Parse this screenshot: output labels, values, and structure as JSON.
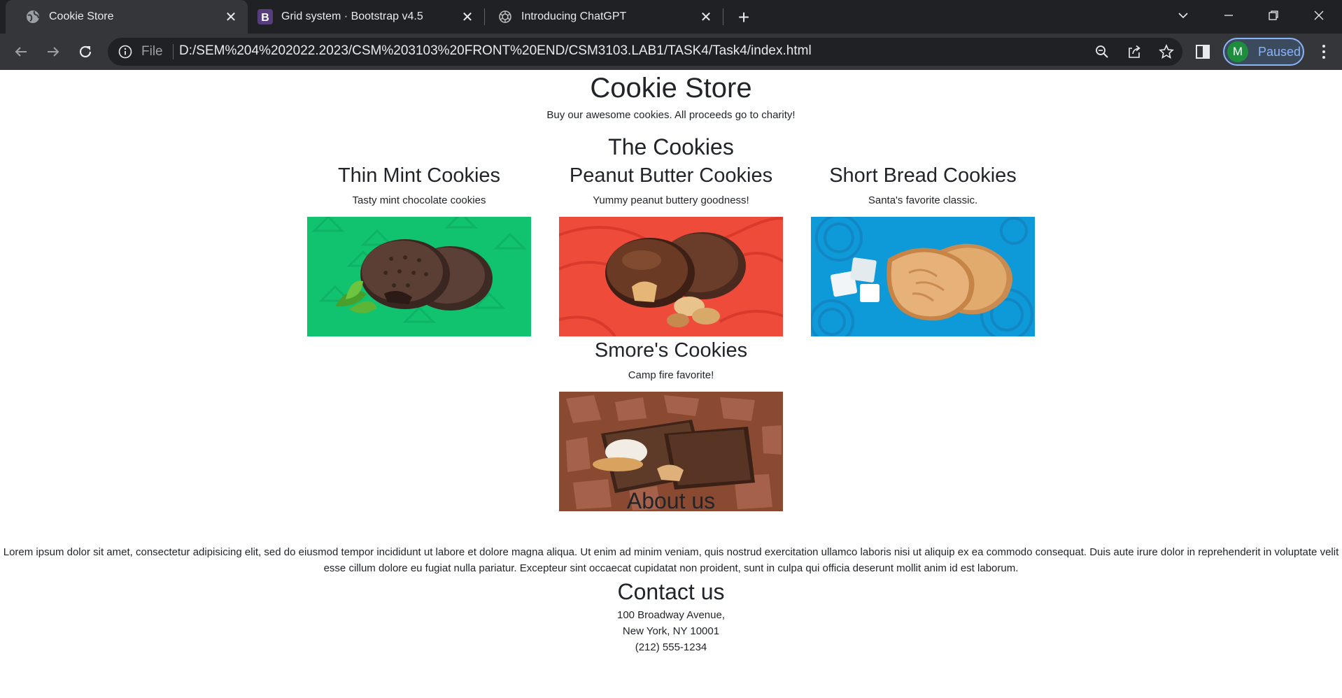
{
  "browser": {
    "tabs": [
      {
        "title": "Cookie Store",
        "favicon": "globe-icon",
        "active": true
      },
      {
        "title": "Grid system · Bootstrap v4.5",
        "favicon": "bootstrap-icon",
        "active": false
      },
      {
        "title": "Introducing ChatGPT",
        "favicon": "openai-icon",
        "active": false
      }
    ],
    "address": {
      "scheme": "File",
      "url": "D:/SEM%204%202022.2023/CSM%203103%20FRONT%20END/CSM3103.LAB1/TASK4/Task4/index.html"
    },
    "profile": {
      "initial": "M",
      "label": "Paused"
    },
    "colors": {
      "tab_bar": "#202124",
      "toolbar": "#35363a",
      "accent": "#8ab4f8"
    }
  },
  "page": {
    "title": "Cookie Store",
    "tagline": "Buy our awesome cookies. All proceeds go to charity!",
    "section_title": "The Cookies",
    "cookies": [
      {
        "name": "Thin Mint Cookies",
        "desc": "Tasty mint chocolate cookies",
        "image": "thin-mint-image",
        "bg": "#11c26f"
      },
      {
        "name": "Peanut Butter Cookies",
        "desc": "Yummy peanut buttery goodness!",
        "image": "peanut-butter-image",
        "bg": "#ef4b3a"
      },
      {
        "name": "Short Bread Cookies",
        "desc": "Santa's favorite classic.",
        "image": "shortbread-image",
        "bg": "#0e9ad9"
      },
      {
        "name": "Smore's Cookies",
        "desc": "Camp fire favorite!",
        "image": "smores-image",
        "bg": "#8a4a31"
      }
    ],
    "about": {
      "title": "About us",
      "text": "Lorem ipsum dolor sit amet, consectetur adipisicing elit, sed do eiusmod tempor incididunt ut labore et dolore magna aliqua. Ut enim ad minim veniam, quis nostrud exercitation ullamco laboris nisi ut aliquip ex ea commodo consequat. Duis aute irure dolor in reprehenderit in voluptate velit esse cillum dolore eu fugiat nulla pariatur. Excepteur sint occaecat cupidatat non proident, sunt in culpa qui officia deserunt mollit anim id est laborum."
    },
    "contact": {
      "title": "Contact us",
      "lines": [
        "100 Broadway Avenue,",
        "New York, NY 10001",
        "(212) 555-1234"
      ]
    }
  }
}
